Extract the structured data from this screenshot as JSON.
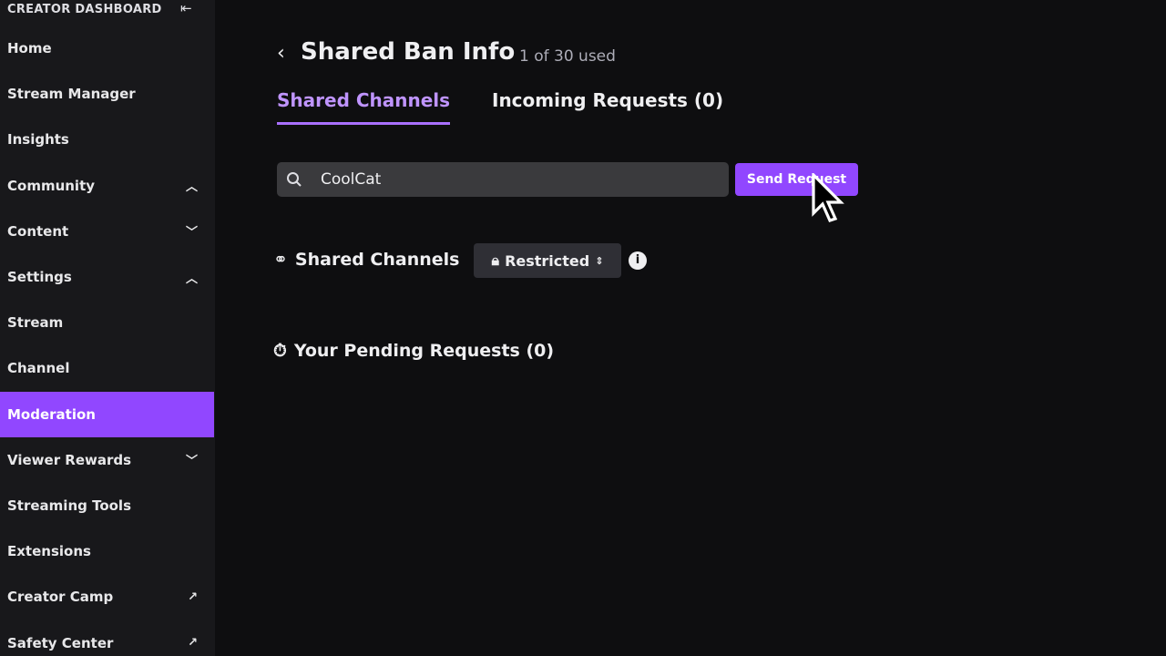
{
  "sidebar": {
    "header": "CREATOR DASHBOARD",
    "items": [
      {
        "label": "Home"
      },
      {
        "label": "Stream Manager"
      },
      {
        "label": "Insights"
      },
      {
        "label": "Community",
        "chevron": "up"
      },
      {
        "label": "Content",
        "chevron": "down"
      },
      {
        "label": "Settings",
        "chevron": "up"
      },
      {
        "label": "Stream"
      },
      {
        "label": "Channel"
      },
      {
        "label": "Moderation",
        "active": true
      },
      {
        "label": "Viewer Rewards",
        "chevron": "down"
      },
      {
        "label": "Streaming Tools"
      },
      {
        "label": "Extensions"
      },
      {
        "label": "Creator Camp",
        "external": true
      },
      {
        "label": "Safety Center",
        "external": true
      }
    ]
  },
  "header": {
    "title": "Shared Ban Info",
    "usage": "1 of 30 used"
  },
  "tabs": [
    {
      "label": "Shared Channels",
      "active": true
    },
    {
      "label": "Incoming Requests (0)"
    }
  ],
  "search": {
    "value": "CoolCat"
  },
  "send_button": "Send Request",
  "shared_section": {
    "label": "Shared Channels",
    "dropdown": "Restricted"
  },
  "pending_section": {
    "label": "Your Pending Requests (0)"
  },
  "colors": {
    "accent": "#9147ff",
    "tab_active": "#bf94ff",
    "sidebar_bg": "#18181b",
    "main_bg": "#0e0e10"
  }
}
